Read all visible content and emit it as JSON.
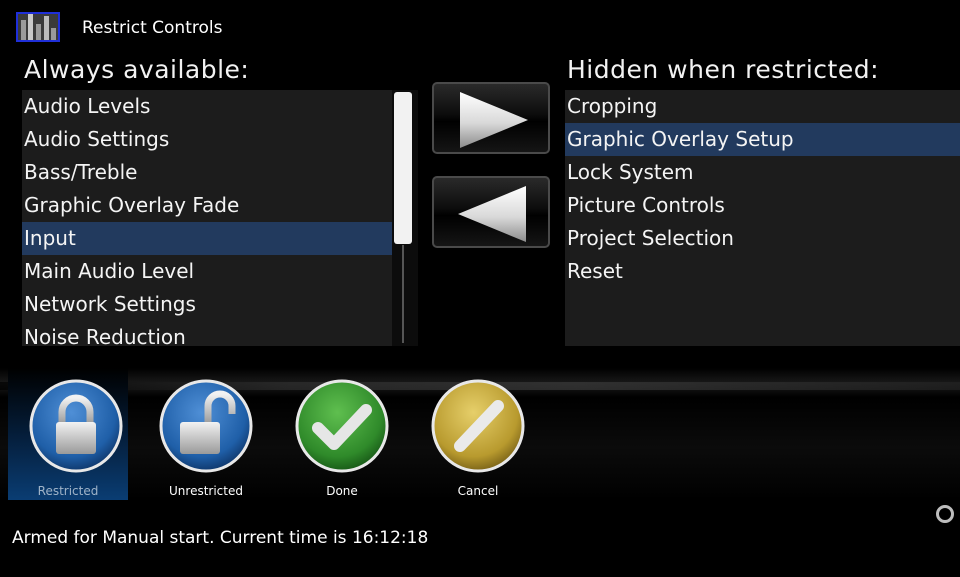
{
  "window": {
    "title": "Restrict Controls"
  },
  "left_panel": {
    "heading": "Always available:",
    "items": [
      {
        "label": "Audio Levels",
        "selected": false
      },
      {
        "label": "Audio Settings",
        "selected": false
      },
      {
        "label": "Bass/Treble",
        "selected": false
      },
      {
        "label": "Graphic Overlay Fade",
        "selected": false
      },
      {
        "label": "Input",
        "selected": true
      },
      {
        "label": "Main Audio Level",
        "selected": false
      },
      {
        "label": "Network Settings",
        "selected": false
      },
      {
        "label": "Noise Reduction",
        "selected": false
      }
    ]
  },
  "right_panel": {
    "heading": "Hidden when restricted:",
    "items": [
      {
        "label": "Cropping",
        "selected": false
      },
      {
        "label": "Graphic Overlay Setup",
        "selected": true
      },
      {
        "label": "Lock System",
        "selected": false
      },
      {
        "label": "Picture Controls",
        "selected": false
      },
      {
        "label": "Project Selection",
        "selected": false
      },
      {
        "label": "Reset",
        "selected": false
      }
    ]
  },
  "move_buttons": {
    "right": {
      "icon": "arrow-right-icon"
    },
    "left": {
      "icon": "arrow-left-icon"
    }
  },
  "toolbar": {
    "restricted": {
      "label": "Restricted",
      "icon": "lock-closed-icon",
      "active": true
    },
    "unrestricted": {
      "label": "Unrestricted",
      "icon": "lock-open-icon",
      "active": false
    },
    "done": {
      "label": "Done",
      "icon": "checkmark-icon",
      "active": false
    },
    "cancel": {
      "label": "Cancel",
      "icon": "cancel-slash-icon",
      "active": false
    }
  },
  "status": {
    "text": "Armed for Manual start. Current time is 16:12:18"
  },
  "colors": {
    "selection": "#223a5e",
    "list_bg": "#1c1c1c",
    "active_tool": "#0a3d73",
    "lock_blue": "#1f5fa8",
    "done_green": "#2f8a2a",
    "cancel_gold": "#b89a2e"
  }
}
